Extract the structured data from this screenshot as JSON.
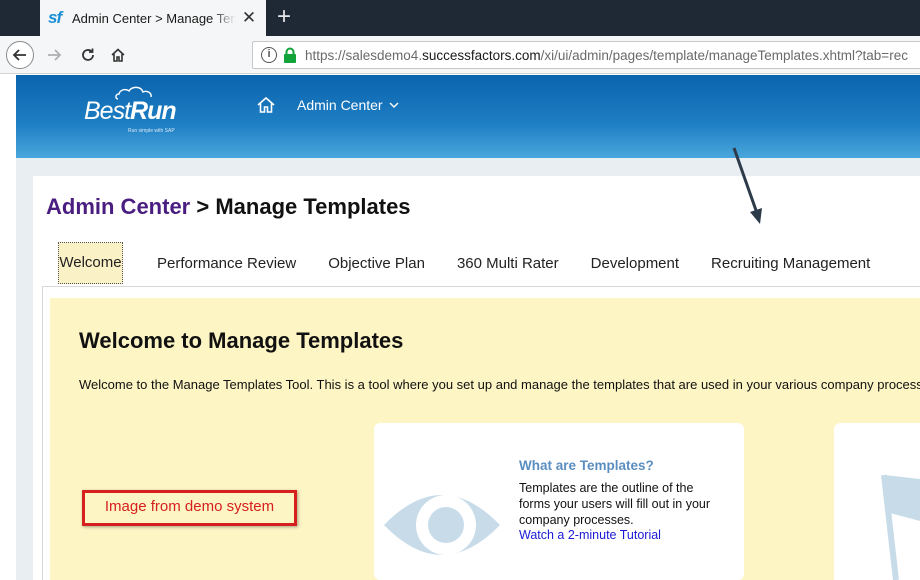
{
  "browser": {
    "tab_title": "Admin Center > Manage Temp",
    "favicon_text": "sf",
    "close_glyph": "✕",
    "new_tab_glyph": "+",
    "url_prefix": "https://salesdemo4.",
    "url_domain": "successfactors.com",
    "url_path": "/xi/ui/admin/pages/template/manageTemplates.xhtml?tab=rec",
    "info_glyph": "i"
  },
  "header": {
    "logo_main": "Best",
    "logo_bold": "Run",
    "logo_tagline": "Run simple with SAP",
    "nav_label": "Admin Center"
  },
  "breadcrumb": {
    "link": "Admin Center",
    "separator": " > ",
    "current": "Manage Templates"
  },
  "tabs": [
    {
      "label": "Welcome",
      "active": true
    },
    {
      "label": "Performance Review"
    },
    {
      "label": "Objective Plan"
    },
    {
      "label": "360 Multi Rater"
    },
    {
      "label": "Development"
    },
    {
      "label": "Recruiting Management"
    }
  ],
  "welcome": {
    "title": "Welcome to Manage Templates",
    "description": "Welcome to the Manage Templates Tool. This is a tool where you set up and manage the templates that are used in your various company processes."
  },
  "card": {
    "title": "What are Templates?",
    "text": "Templates are the outline of the forms your users will fill out in your company processes.",
    "link": "Watch a 2-minute Tutorial"
  },
  "annotation": {
    "label": "Image from demo system",
    "color": "#d61f1f"
  },
  "colors": {
    "header_blue": "#0b63ad",
    "breadcrumb_link": "#4a1e80",
    "welcome_bg": "#fdf5c4",
    "card_title": "#5b8ec0",
    "link": "#1a1ad6"
  }
}
